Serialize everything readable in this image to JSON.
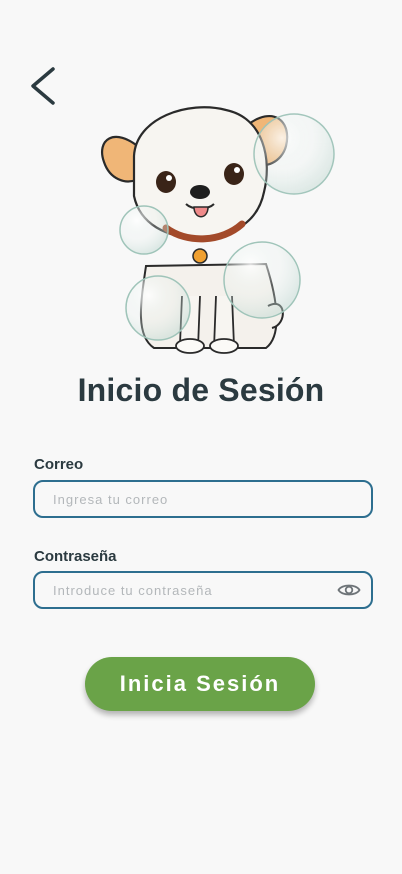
{
  "icons": {
    "back": "chevron-left-icon",
    "visibility": "eye-icon"
  },
  "hero": {
    "image": "puppy-with-bubbles-illustration"
  },
  "title": "Inicio de Sesión",
  "email": {
    "label": "Correo",
    "placeholder": "Ingresa tu correo",
    "value": ""
  },
  "password": {
    "label": "Contraseña",
    "placeholder": "Introduce tu contraseña",
    "value": ""
  },
  "login_button": {
    "label": "Inicia Sesión"
  },
  "colors": {
    "accent": "#6aa348",
    "field_border": "#2d6e8f",
    "text": "#2b3a40",
    "background": "#f8f8f8"
  }
}
